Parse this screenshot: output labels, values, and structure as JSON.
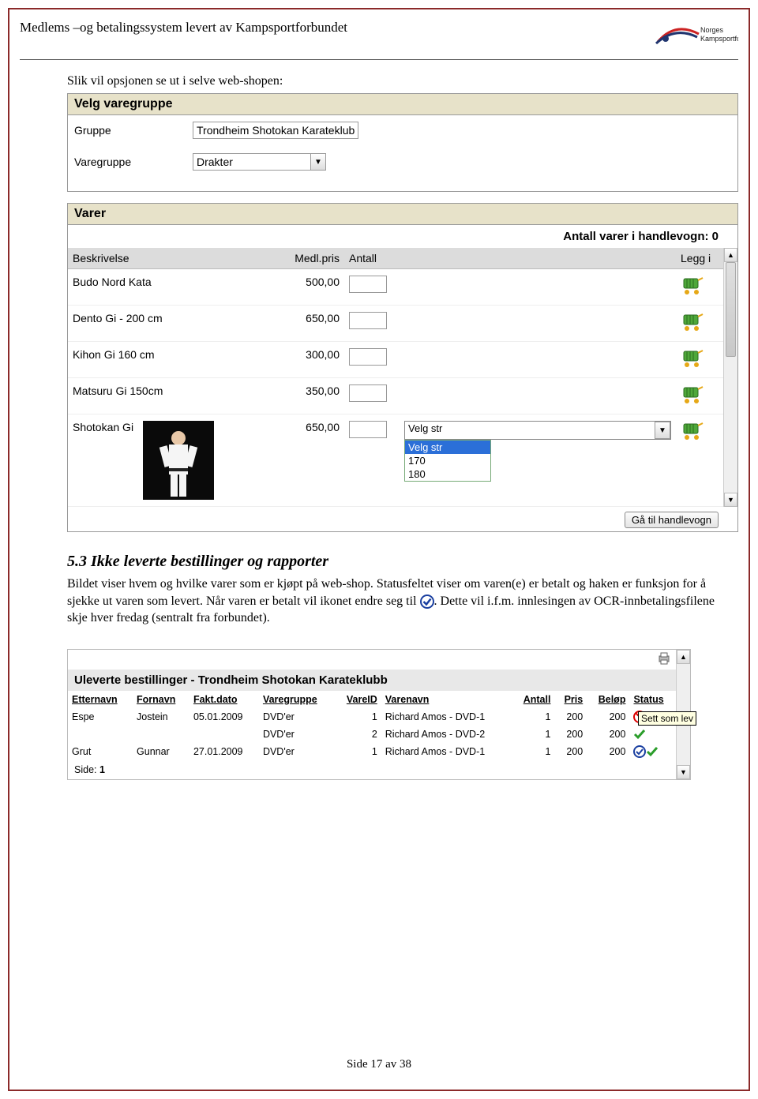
{
  "header": {
    "title": "Medlems –og betalingssystem levert av Kampsportforbundet",
    "logo_text_top": "Norges",
    "logo_text_bottom": "Kampsportforbund"
  },
  "intro": "Slik vil opsjonen se ut i selve web-shopen:",
  "velg_varegruppe": {
    "title": "Velg varegruppe",
    "gruppe_label": "Gruppe",
    "gruppe_value": "Trondheim Shotokan Karateklub",
    "varegruppe_label": "Varegruppe",
    "varegruppe_value": "Drakter"
  },
  "varer": {
    "title": "Varer",
    "cart_text": "Antall varer i handlevogn: 0",
    "cols": {
      "beskrivelse": "Beskrivelse",
      "medlpris": "Medl.pris",
      "antall": "Antall",
      "leggi": "Legg i"
    },
    "items": [
      {
        "name": "Budo Nord Kata",
        "price": "500,00"
      },
      {
        "name": "Dento Gi - 200 cm",
        "price": "650,00"
      },
      {
        "name": "Kihon Gi 160 cm",
        "price": "300,00"
      },
      {
        "name": "Matsuru Gi 150cm",
        "price": "350,00"
      },
      {
        "name": "Shotokan Gi",
        "price": "650,00"
      }
    ],
    "size_label": "Velg str",
    "size_options": [
      "Velg str",
      "170",
      "180"
    ],
    "go_cart": "Gå til handlevogn"
  },
  "section": {
    "heading": "5.3  Ikke leverte bestillinger og rapporter",
    "p1a": "Bildet viser hvem og hvilke varer som er kjøpt på web-shop. Statusfeltet viser om varen(e) er betalt og haken er funksjon for å sjekke ut varen som levert. Når varen er betalt vil ikonet endre seg til ",
    "p1b": ". Dette vil i.f.m. innlesingen av OCR-innbetalingsfilene skje hver fredag (sentralt fra forbundet)."
  },
  "report": {
    "title": "Uleverte bestillinger - Trondheim Shotokan Karateklubb",
    "cols": {
      "etter": "Etternavn",
      "for": "Fornavn",
      "dato": "Fakt.dato",
      "vg": "Varegruppe",
      "vid": "VareID",
      "vn": "Varenavn",
      "ant": "Antall",
      "pris": "Pris",
      "belop": "Beløp",
      "status": "Status"
    },
    "rows": [
      {
        "etter": "Espe",
        "for": "Jostein",
        "dato": "05.01.2009",
        "vg": "DVD'er",
        "vid": "1",
        "vn": "Richard Amos - DVD-1",
        "ant": "1",
        "pris": "200",
        "belop": "200",
        "status": "no-check"
      },
      {
        "etter": "",
        "for": "",
        "dato": "",
        "vg": "DVD'er",
        "vid": "2",
        "vn": "Richard Amos - DVD-2",
        "ant": "1",
        "pris": "200",
        "belop": "200",
        "status": "check"
      },
      {
        "etter": "Grut",
        "for": "Gunnar",
        "dato": "27.01.2009",
        "vg": "DVD'er",
        "vid": "1",
        "vn": "Richard Amos - DVD-1",
        "ant": "1",
        "pris": "200",
        "belop": "200",
        "status": "paid-check"
      }
    ],
    "side_label": "Side:",
    "side_value": "1",
    "tooltip": "Sett som lev"
  },
  "footer": "Side 17 av 38"
}
